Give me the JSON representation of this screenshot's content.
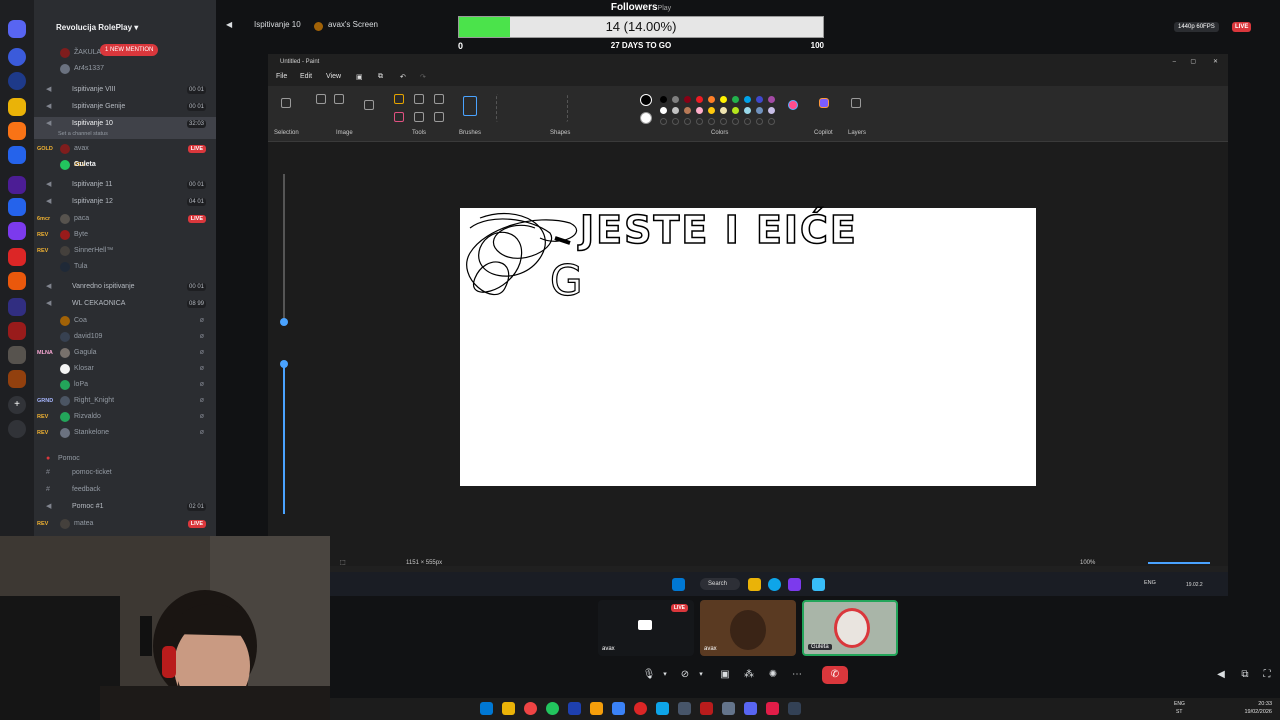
{
  "server": {
    "name": "Revolucija RolePlay"
  },
  "mention": {
    "badge": "1 NEW MENTION"
  },
  "channels": {
    "top_users": [
      "ŽAKULA",
      "Ar4s1337"
    ],
    "ispitivanje8": "Ispitivanje VIII",
    "ispitivanje8_count": "00 01",
    "genije": "Ispitivanje Genije",
    "genije_count": "00 01",
    "ispitivanje10": "Ispitivanje 10",
    "ispitivanje10_count": "32:03",
    "ispitivanje10_status": "Set a channel status",
    "u_avax": "avax",
    "u_avax_tag": "GOLD",
    "u_guleta": "Guleta",
    "u_guleta_tag": "REV",
    "ispitivanje11": "Ispitivanje 11",
    "ispitivanje11_count": "00 01",
    "ispitivanje12": "Ispitivanje 12",
    "ispitivanje12_count": "04 01",
    "u_paca": "paca",
    "u_paca_tag": "6mcr",
    "u_byte": "Byte",
    "u_byte_tag": "REV",
    "u_sinner": "SinnerHell™",
    "u_sinner_tag": "REV",
    "u_tula": "Tula",
    "vanredno": "Vanredno ispitivanje",
    "vanredno_count": "00 01",
    "wl": "WL CEKAONICA",
    "wl_count": "08 99",
    "wl_users": [
      "Coa",
      "david109",
      "Gagula",
      "Klosar",
      "loPa",
      "Right_Knight",
      "Rizvaldo",
      "Stankelone"
    ],
    "wl_tags": [
      "",
      "",
      "MLNA",
      "",
      "",
      "GRND",
      "REV",
      "REV"
    ],
    "pomoc_cat": "Pomoc",
    "pomoc_ticket": "pomoc-ticket",
    "feedback": "feedback",
    "pomoc1": "Pomoc #1",
    "pomoc1_count": "02 01",
    "u_matea": "matea",
    "u_matea_tag": "REV",
    "live": "LIVE"
  },
  "topbar": {
    "voice_channel": "Ispitivanje 10",
    "screen": "avax's Screen",
    "quality": "1440p 60FPS",
    "live": "LIVE"
  },
  "followers": {
    "title": "Followers",
    "title_suffix": "Play",
    "progress_text": "14 (14.00%)",
    "progress": 0.14,
    "min": "0",
    "max": "100",
    "countdown": "27 DAYS TO GO"
  },
  "paint": {
    "title": "Untitled - Paint",
    "menu": [
      "File",
      "Edit",
      "View"
    ],
    "groups": [
      "Selection",
      "Image",
      "Tools",
      "Brushes",
      "Shapes",
      "Colors",
      "Copilot",
      "Layers"
    ],
    "canvas_size": "1151 × 555px",
    "zoom": "100%",
    "drawing_text": "JESTE I EIĆE",
    "drawing_text2": "G"
  },
  "inner_taskbar": {
    "search": "Search",
    "lang": "ENG",
    "lang2": "ST",
    "date": "19.02.2"
  },
  "tiles": [
    {
      "label": "avax",
      "live": "LIVE"
    },
    {
      "label": "avax"
    },
    {
      "label": "Guleta"
    }
  ],
  "wintaskbar": {
    "time": "20:33",
    "date": "19/02/2026",
    "lang": "ENG",
    "lang2": "ST"
  },
  "colors": {
    "accent": "#5865f2",
    "live": "#da373c",
    "fill": "#4be34b"
  }
}
